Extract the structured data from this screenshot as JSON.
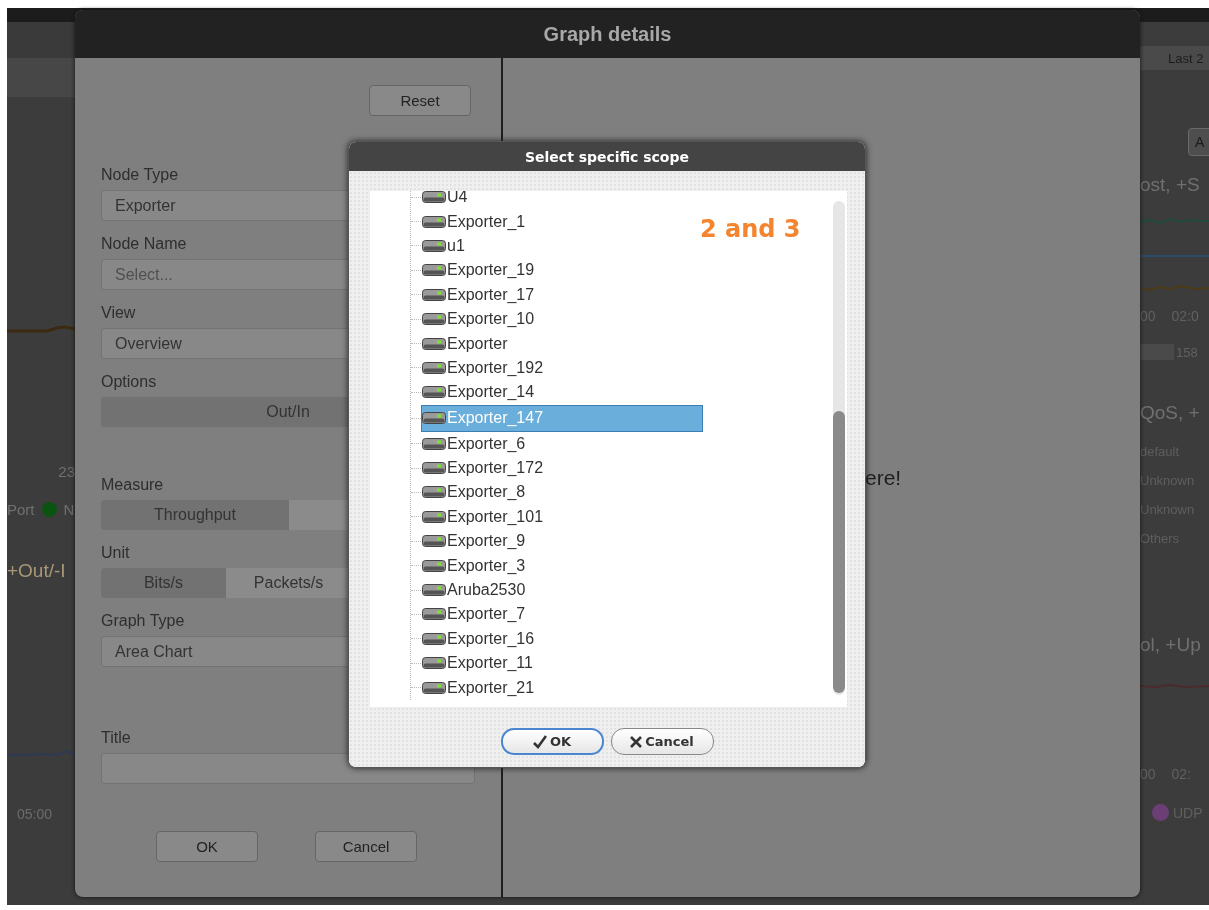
{
  "background": {
    "left_panel": {
      "axis_label": "23",
      "legend_text": "Port",
      "legend_item": {
        "label": "N",
        "color": "#0b5310"
      },
      "chart_title": "+Out/-I",
      "time_label": "05:00"
    },
    "right_panel": {
      "range_tab": "Last 2",
      "button": "A",
      "chart_1": {
        "title": "ost, +S",
        "time_labels": [
          "00",
          "02:0"
        ],
        "value": "158"
      },
      "chart_2": {
        "title": "QoS, +",
        "legend": [
          "default",
          "Unknown",
          "Unknown",
          "Others"
        ]
      },
      "chart_3": {
        "title": "ol, +Up",
        "time_labels": [
          "00",
          "02:"
        ],
        "legend_item": {
          "label": "UDP",
          "color": "#6b3f76"
        }
      }
    }
  },
  "dialog": {
    "title": "Graph details",
    "reset": "Reset",
    "fields": [
      {
        "kind": "select",
        "label": "Node Type",
        "value": "Exporter"
      },
      {
        "kind": "select",
        "label": "Node Name",
        "placeholder": "Select..."
      },
      {
        "kind": "select",
        "label": "View",
        "value": "Overview"
      },
      {
        "kind": "segmented",
        "label": "Options",
        "options": [
          {
            "label": "Out/In",
            "selected": true
          }
        ]
      },
      {
        "kind": "segmented",
        "label": "Measure",
        "options": [
          {
            "label": "Throughput",
            "selected": true
          }
        ]
      },
      {
        "kind": "segmented",
        "label": "Unit",
        "options": [
          {
            "label": "Bits/s",
            "selected": true
          },
          {
            "label": "Packets/s",
            "selected": false
          }
        ]
      },
      {
        "kind": "select",
        "label": "Graph Type",
        "value": "Area Chart"
      },
      {
        "kind": "text",
        "label": "Title"
      }
    ],
    "buttons": [
      "OK",
      "Cancel"
    ],
    "preview_message": "ere!"
  },
  "scope_dialog": {
    "title": "Select specific scope",
    "annotation": "2 and 3",
    "items": [
      {
        "label": "U4",
        "selected": false
      },
      {
        "label": "Exporter_1",
        "selected": false
      },
      {
        "label": "u1",
        "selected": false
      },
      {
        "label": "Exporter_19",
        "selected": false
      },
      {
        "label": "Exporter_17",
        "selected": false
      },
      {
        "label": "Exporter_10",
        "selected": false
      },
      {
        "label": "Exporter",
        "selected": false
      },
      {
        "label": "Exporter_192",
        "selected": false
      },
      {
        "label": "Exporter_14",
        "selected": false
      },
      {
        "label": "Exporter_147",
        "selected": true
      },
      {
        "label": "Exporter_6",
        "selected": false
      },
      {
        "label": "Exporter_172",
        "selected": false
      },
      {
        "label": "Exporter_8",
        "selected": false
      },
      {
        "label": "Exporter_101",
        "selected": false
      },
      {
        "label": "Exporter_9",
        "selected": false
      },
      {
        "label": "Exporter_3",
        "selected": false
      },
      {
        "label": "Aruba2530",
        "selected": false
      },
      {
        "label": "Exporter_7",
        "selected": false
      },
      {
        "label": "Exporter_16",
        "selected": false
      },
      {
        "label": "Exporter_11",
        "selected": false
      },
      {
        "label": "Exporter_21",
        "selected": false
      }
    ],
    "buttons": [
      {
        "kind": "ok",
        "label": "OK"
      },
      {
        "kind": "cancel",
        "label": "Cancel"
      }
    ]
  }
}
